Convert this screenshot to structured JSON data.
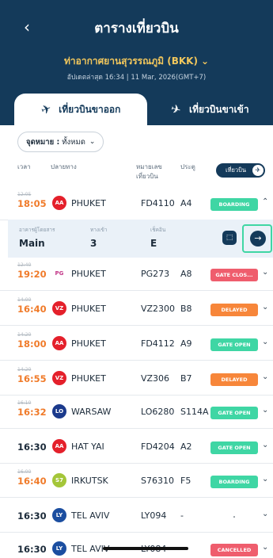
{
  "header": {
    "title": "ตารางเที่ยวบิน",
    "airport": "ท่าอากาศยานสุวรรณภูมิ (BKK)",
    "updated": "อัปเดตล่าสุด 16:34 | 11 Mar, 2026(GMT+7)"
  },
  "tabs": [
    {
      "label": "เที่ยวบินขาออก"
    },
    {
      "label": "เที่ยวบินขาเข้า"
    }
  ],
  "filter": {
    "label": "จุดหมาย :",
    "value": "ทั้งหมด"
  },
  "columns": {
    "time": "เวลา",
    "destination": "ปลายทาง",
    "flight": "หมายเลข เที่ยวบิน",
    "gate": "ประตู",
    "toggle": "เที่ยวบิน"
  },
  "expanded": {
    "terminal_label": "อาคารผู้โดยสาร",
    "terminal": "Main",
    "entrance_label": "ทางเข้า",
    "entrance": "3",
    "checkin_label": "เช็คอิน",
    "checkin": "E"
  },
  "flights": [
    {
      "sched": "12:05",
      "time": "18:05",
      "dest": "PHUKET",
      "flight": "FD4110",
      "gate": "A4",
      "status": "BOARDING",
      "status_color": "#3fd6a4",
      "logo_color": "#e4202b",
      "logo": "AA"
    },
    {
      "sched": "12:40",
      "time": "19:20",
      "dest": "PHUKET",
      "flight": "PG273",
      "gate": "A8",
      "status": "GATE CLOS...",
      "status_color": "#ef5d6d",
      "logo_color": "#ffffff",
      "logo": "PG"
    },
    {
      "sched": "14:00",
      "time": "16:40",
      "dest": "PHUKET",
      "flight": "VZ2300",
      "gate": "B8",
      "status": "DELAYED",
      "status_color": "#f7863a",
      "logo_color": "#e4202b",
      "logo": "VZ"
    },
    {
      "sched": "14:20",
      "time": "18:00",
      "dest": "PHUKET",
      "flight": "FD4112",
      "gate": "A9",
      "status": "GATE OPEN",
      "status_color": "#3fd6a4",
      "logo_color": "#e4202b",
      "logo": "AA"
    },
    {
      "sched": "14:20",
      "time": "16:55",
      "dest": "PHUKET",
      "flight": "VZ306",
      "gate": "B7",
      "status": "DELAYED",
      "status_color": "#f7863a",
      "logo_color": "#e4202b",
      "logo": "VZ"
    },
    {
      "sched": "16:10",
      "time": "16:32",
      "dest": "WARSAW",
      "flight": "LO6280",
      "gate": "S114A",
      "status": "GATE OPEN",
      "status_color": "#3fd6a4",
      "logo_color": "#1b3a8c",
      "logo": "LO"
    },
    {
      "sched": "",
      "time": "16:30",
      "dest": "HAT YAI",
      "flight": "FD4204",
      "gate": "A2",
      "status": "GATE OPEN",
      "status_color": "#3fd6a4",
      "logo_color": "#e4202b",
      "logo": "AA"
    },
    {
      "sched": "16:00",
      "time": "16:40",
      "dest": "IRKUTSK",
      "flight": "S76310",
      "gate": "F5",
      "status": "BOARDING",
      "status_color": "#3fd6a4",
      "logo_color": "#a4c639",
      "logo": "S7"
    },
    {
      "sched": "",
      "time": "16:30",
      "dest": "TEL AVIV",
      "flight": "LY094",
      "gate": "-",
      "status": "-",
      "status_color": "#ffffff",
      "logo_color": "#1b4ea0",
      "logo": "LY"
    },
    {
      "sched": "",
      "time": "16:30",
      "dest": "TEL AVIV",
      "flight": "LY084",
      "gate": "-",
      "status": "CANCELLED",
      "status_color": "#ef5d6d",
      "logo_color": "#1b4ea0",
      "logo": "LY"
    }
  ]
}
